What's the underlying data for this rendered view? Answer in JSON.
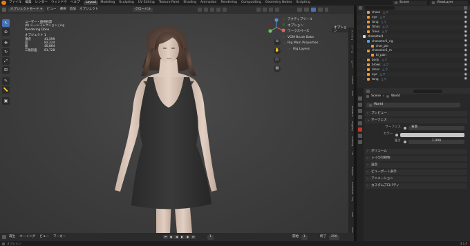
{
  "topbar": {
    "menus": [
      "ファイル",
      "編集",
      "レンダー",
      "ウィンドウ",
      "ヘルプ"
    ],
    "workspaces": [
      "Layout",
      "Modeling",
      "Sculpting",
      "UV Editing",
      "Texture Paint",
      "Shading",
      "Animation",
      "Rendering",
      "Compositing",
      "Geometry Nodes",
      "Scripting"
    ],
    "active_workspace": "Layout",
    "scene": "Scene",
    "view_layer": "ViewLayer"
  },
  "viewport_header": {
    "mode": "オブジェクトモード",
    "menus": [
      "ビュー",
      "選択",
      "追加",
      "オブジェクト"
    ],
    "transform_orientation": "グローバル"
  },
  "stats": {
    "view_name": "ユーザー・透視投影",
    "collection": "(0) シーンコレクション | rig",
    "status": "Rendering Done",
    "rows": [
      {
        "label": "オブジェクト",
        "value": "1"
      },
      {
        "label": "頂点",
        "value": "41,599"
      },
      {
        "label": "辺",
        "value": "82,224"
      },
      {
        "label": "面",
        "value": "40,864"
      },
      {
        "label": "三角形面",
        "value": "81,728"
      }
    ]
  },
  "npanel": {
    "options_label": "オプション",
    "items": [
      {
        "label": "アクティブツール",
        "expanded": false
      },
      {
        "label": "オプション",
        "expanded": false
      },
      {
        "label": "ワークスペース",
        "expanded": false
      },
      {
        "label": "VGM Brush Bake",
        "expanded": false
      },
      {
        "label": "Rig Main Properties",
        "expanded": true
      },
      {
        "label": "Rig Layers",
        "expanded": false,
        "sub": true
      }
    ]
  },
  "side_tabs": [
    "アイテム",
    "ツール",
    "ビュー",
    "Create",
    "Edit",
    "BlendKit",
    "Rigging",
    "AutoRig",
    "UV",
    "Retopo",
    "Animation",
    "Lily",
    "Hair",
    "Misc"
  ],
  "timeline": {
    "menus": [
      "再生",
      "キーイング",
      "ビュー",
      "マーカー"
    ],
    "current_frame": "1",
    "start_label": "開始",
    "start": "1",
    "end_label": "終了",
    "end": "250"
  },
  "statusbar": {
    "left": "オプション",
    "version": "4.1.0"
  },
  "outliner": {
    "rows": [
      {
        "indent": 1,
        "name": "shoes",
        "mods": "△ ▽",
        "type": "mesh"
      },
      {
        "indent": 1,
        "name": "eye",
        "mods": "△ ▽",
        "type": "mesh"
      },
      {
        "indent": 1,
        "name": "tong",
        "mods": "△ ▽",
        "type": "mesh"
      },
      {
        "indent": 1,
        "name": "Tshes",
        "mods": "△ ▽",
        "type": "mesh"
      },
      {
        "indent": 1,
        "name": "Trees",
        "mods": "△ ▽",
        "type": "mesh"
      },
      {
        "indent": 0,
        "name": "character1",
        "mods": "",
        "type": "collection"
      },
      {
        "indent": 1,
        "name": "character1_rig",
        "mods": "",
        "type": "armature"
      },
      {
        "indent": 2,
        "name": "char_pkr",
        "mods": "",
        "type": "bone"
      },
      {
        "indent": 1,
        "name": "character1_m",
        "mods": "",
        "type": "mesh"
      },
      {
        "indent": 2,
        "name": "bi_pain",
        "mods": "",
        "type": "mesh"
      },
      {
        "indent": 1,
        "name": "body",
        "mods": "△ ▽",
        "type": "mesh"
      },
      {
        "indent": 1,
        "name": "brows",
        "mods": "△ ▽",
        "type": "mesh"
      },
      {
        "indent": 1,
        "name": "dress",
        "mods": "△ ▽",
        "type": "mesh"
      },
      {
        "indent": 1,
        "name": "eye",
        "mods": "△ ▽",
        "type": "mesh"
      },
      {
        "indent": 1,
        "name": "tong",
        "mods": "△ ▽",
        "type": "mesh"
      }
    ]
  },
  "properties": {
    "scene": "Scene",
    "world": "World",
    "world_field": "World",
    "sections": [
      {
        "label": "プレビュー",
        "expanded": false
      },
      {
        "label": "サーフェス",
        "expanded": true
      },
      {
        "label": "ボリューム",
        "expanded": false
      },
      {
        "label": "レイの可視性",
        "expanded": false
      },
      {
        "label": "設定",
        "expanded": false
      },
      {
        "label": "ビューポート表示",
        "expanded": false
      },
      {
        "label": "アニメーション",
        "expanded": false
      },
      {
        "label": "カスタムプロパティ",
        "expanded": false
      }
    ],
    "surface": {
      "surface_label": "サーフェス",
      "surface_value": "背景",
      "color_label": "カラー",
      "strength_label": "強さ",
      "strength_value": "1.000"
    }
  },
  "colors": {
    "accent": "#4772b3",
    "blender_orange": "#e87d0d",
    "world_tab": "#c0392b"
  }
}
